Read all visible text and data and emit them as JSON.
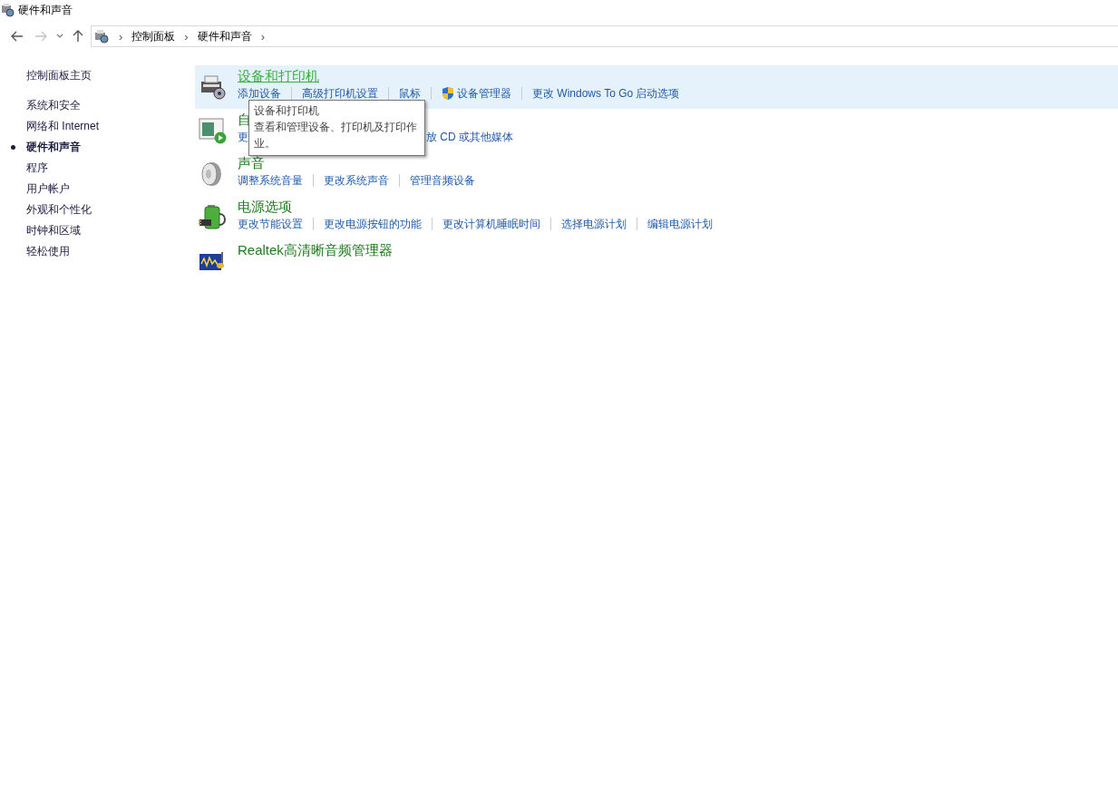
{
  "window": {
    "title": "硬件和声音"
  },
  "address_bar": {
    "crumbs": [
      {
        "chevron": "›",
        "label": "控制面板"
      },
      {
        "chevron": "›",
        "label": "硬件和声音"
      }
    ],
    "trailing_chevron": "›"
  },
  "sidebar": {
    "home": "控制面板主页",
    "items": [
      {
        "label": "系统和安全",
        "selected": false
      },
      {
        "label": "网络和 Internet",
        "selected": false
      },
      {
        "label": "硬件和声音",
        "selected": true
      },
      {
        "label": "程序",
        "selected": false
      },
      {
        "label": "用户帐户",
        "selected": false
      },
      {
        "label": "外观和个性化",
        "selected": false
      },
      {
        "label": "时钟和区域",
        "selected": false
      },
      {
        "label": "轻松使用",
        "selected": false
      }
    ]
  },
  "categories": [
    {
      "kind": "printer",
      "title": "设备和打印机",
      "hovered": true,
      "covered": false,
      "links": [
        {
          "label": "添加设备",
          "shield": false
        },
        {
          "label": "高级打印机设置",
          "shield": false
        },
        {
          "label": "鼠标",
          "shield": false
        },
        {
          "label": "设备管理器",
          "shield": true
        },
        {
          "label": "更改 Windows To Go 启动选项",
          "shield": false
        }
      ]
    },
    {
      "kind": "autoplay",
      "title": "自",
      "hovered": false,
      "covered": true,
      "links": [
        {
          "label": "更",
          "shield": false
        },
        {
          "label": "放 CD 或其他媒体",
          "shield": false
        }
      ]
    },
    {
      "kind": "sound",
      "title": "声音",
      "hovered": false,
      "covered": false,
      "links": [
        {
          "label": "调整系统音量",
          "shield": false
        },
        {
          "label": "更改系统声音",
          "shield": false
        },
        {
          "label": "管理音频设备",
          "shield": false
        }
      ]
    },
    {
      "kind": "power",
      "title": "电源选项",
      "hovered": false,
      "covered": false,
      "links": [
        {
          "label": "更改节能设置",
          "shield": false
        },
        {
          "label": "更改电源按钮的功能",
          "shield": false
        },
        {
          "label": "更改计算机睡眠时间",
          "shield": false
        },
        {
          "label": "选择电源计划",
          "shield": false
        },
        {
          "label": "编辑电源计划",
          "shield": false
        }
      ]
    },
    {
      "kind": "realtek",
      "title": "Realtek高清晰音频管理器",
      "hovered": false
    }
  ],
  "tooltip": {
    "title": "设备和打印机",
    "text": "查看和管理设备、打印机及打印作业。"
  }
}
